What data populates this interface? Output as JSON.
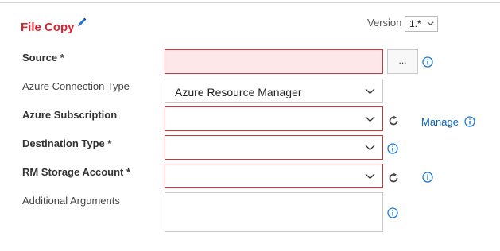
{
  "task": {
    "title": "File Copy",
    "version_label": "Version",
    "version_value": "1.*"
  },
  "fields": {
    "source": {
      "label": "Source *",
      "value": "",
      "browse_label": "..."
    },
    "connection_type": {
      "label": "Azure Connection Type",
      "value": "Azure Resource Manager"
    },
    "subscription": {
      "label": "Azure Subscription",
      "value": "",
      "manage_label": "Manage"
    },
    "destination_type": {
      "label": "Destination Type *",
      "value": ""
    },
    "storage_account": {
      "label": "RM Storage Account *",
      "value": ""
    },
    "additional_arguments": {
      "label": "Additional Arguments",
      "value": ""
    }
  },
  "colors": {
    "title": "#e0202e",
    "error_border": "#d13438",
    "error_fill": "#fde7e9",
    "link": "#0a62bd"
  },
  "icons": [
    "edit-pencil-icon",
    "chevron-down-icon",
    "info-icon",
    "refresh-icon"
  ]
}
